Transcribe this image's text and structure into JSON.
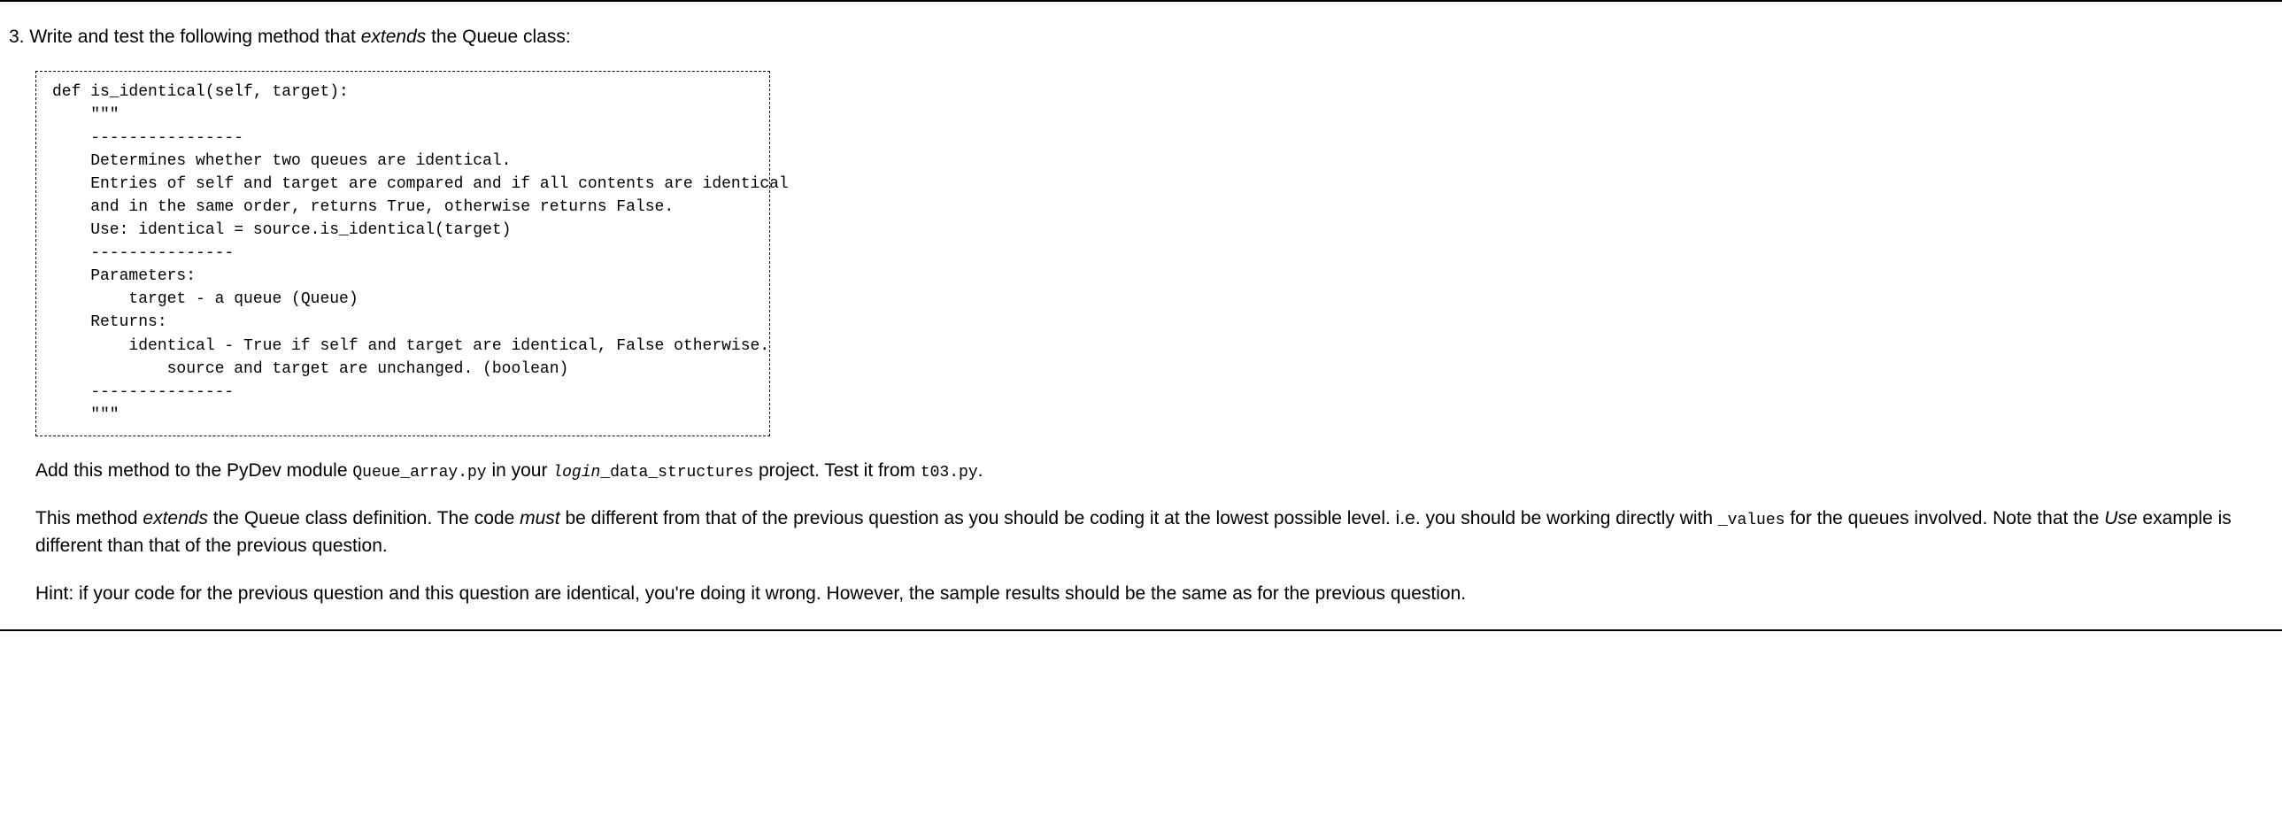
{
  "question": {
    "number": "3.",
    "intro_prefix": "Write and test the following method that ",
    "intro_italic": "extends",
    "intro_suffix": " the Queue class:"
  },
  "code": {
    "line01": "def is_identical(self, target):",
    "line02": "    \"\"\"",
    "line03": "    ----------------",
    "line04": "    Determines whether two queues are identical.",
    "line05": "    Entries of self and target are compared and if all contents are identical",
    "line06": "    and in the same order, returns True, otherwise returns False.",
    "line07": "    Use: identical = source.is_identical(target)",
    "line08": "    ---------------",
    "line09": "    Parameters:",
    "line10": "        target - a queue (Queue)",
    "line11": "    Returns:",
    "line12": "        identical - True if self and target are identical, False otherwise.",
    "line13": "            source and target are unchanged. (boolean)",
    "line14": "    ---------------",
    "line15": "    \"\"\""
  },
  "para1": {
    "p1": "Add this method to the PyDev module ",
    "m1": "Queue_array.py",
    "p2": " in your ",
    "m2_italic": "login",
    "m2_rest": "_data_structures",
    "p3": " project. Test it from ",
    "m3": "t03.py",
    "p4": "."
  },
  "para2": {
    "p1": "This method ",
    "i1": "extends",
    "p2": " the Queue class definition. The code ",
    "i2": "must",
    "p3": " be different from that of the previous question as you should be coding it at the lowest possible level. i.e. you should be working directly with ",
    "m1": "_values",
    "p4": " for the queues involved. Note that the ",
    "i3": "Use",
    "p5": " example is different than that of the previous question."
  },
  "para3": {
    "p1": "Hint: if your code for the previous question and this question are identical, you're doing it wrong. However, the sample results should be the same as for the previous question."
  }
}
